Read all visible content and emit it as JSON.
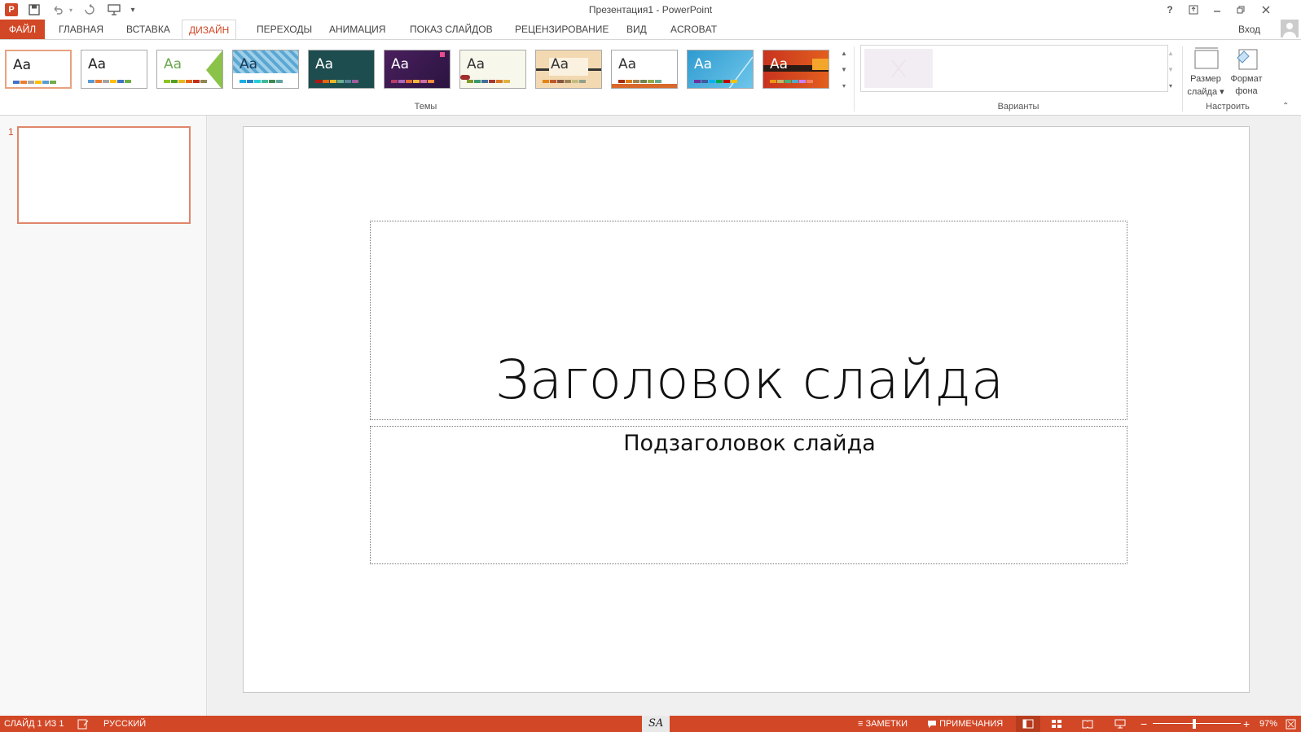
{
  "window": {
    "title": "Презентация1 - PowerPoint",
    "sign_in": "Вход",
    "help": "?"
  },
  "quick_access": {
    "app_icon": "P",
    "save_icon": "save-icon",
    "undo_icon": "undo-icon",
    "redo_icon": "redo-icon",
    "present_icon": "present-icon",
    "customize_icon": "customize-icon"
  },
  "tabs": [
    {
      "label": "ФАЙЛ"
    },
    {
      "label": "ГЛАВНАЯ"
    },
    {
      "label": "ВСТАВКА"
    },
    {
      "label": "ДИЗАЙН"
    },
    {
      "label": "ПЕРЕХОДЫ"
    },
    {
      "label": "АНИМАЦИЯ"
    },
    {
      "label": "ПОКАЗ СЛАЙДОВ"
    },
    {
      "label": "РЕЦЕНЗИРОВАНИЕ"
    },
    {
      "label": "ВИД"
    },
    {
      "label": "ACROBAT"
    }
  ],
  "ribbon": {
    "themes_group_label": "Темы",
    "variants_group_label": "Варианты",
    "customize_group_label": "Настроить",
    "theme_sample": "Aa",
    "slide_size_label_1": "Размер",
    "slide_size_label_2": "слайда",
    "format_bg_label_1": "Формат",
    "format_bg_label_2": "фона"
  },
  "theme_colors": {
    "accent": "#d24726",
    "status_bar": "#d24726"
  },
  "thumbnail": {
    "number": "1"
  },
  "slide": {
    "title": "Заголовок слайда",
    "subtitle": "Подзаголовок слайда"
  },
  "status": {
    "slide_info": "СЛАЙД 1 ИЗ 1",
    "language": "РУССКИЙ",
    "center_mark": "SA",
    "notes": "ЗАМЕТКИ",
    "comments": "ПРИМЕЧАНИЯ",
    "zoom": "97%",
    "zoom_level_percent": 97
  }
}
